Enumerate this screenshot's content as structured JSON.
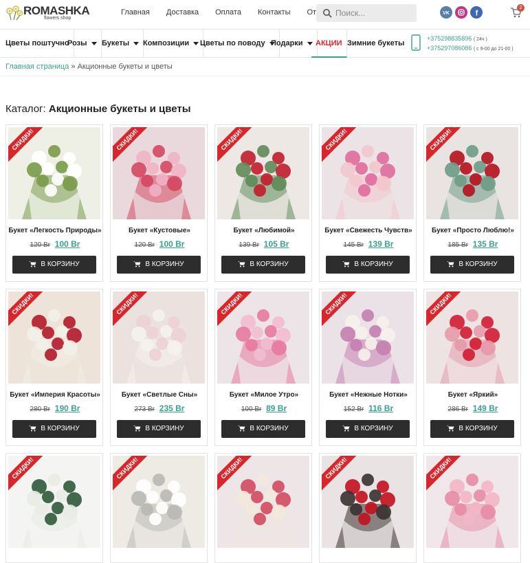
{
  "logo": {
    "brand": "ROMASHKA",
    "tagline": "flowers shop"
  },
  "topnav": [
    "Главная",
    "Доставка",
    "Оплата",
    "Контакты",
    "Отзывы"
  ],
  "search": {
    "placeholder": "Поиск..."
  },
  "social": [
    {
      "name": "vk-icon",
      "label": "VK",
      "color": "#5a7fa6"
    },
    {
      "name": "instagram-icon",
      "label": "",
      "color": "#c13584"
    },
    {
      "name": "facebook-icon",
      "label": "f",
      "color": "#4267b2"
    }
  ],
  "cart": {
    "count": "2"
  },
  "catnav": [
    {
      "label": "Цветы поштучно",
      "caret": false
    },
    {
      "label": "Розы",
      "caret": true
    },
    {
      "label": "Букеты",
      "caret": true
    },
    {
      "label": "Композиции",
      "caret": true
    },
    {
      "label": "Цветы по поводу",
      "caret": true
    },
    {
      "label": "Подарки",
      "caret": true
    },
    {
      "label": "АКЦИИ",
      "caret": false,
      "sale": true
    },
    {
      "label": "Зимние букеты",
      "caret": false
    }
  ],
  "phones": [
    {
      "number": "+375298835896",
      "note": "( 24ч )"
    },
    {
      "number": "+375297086086",
      "note": "( с 9-00 до 21-00 )"
    }
  ],
  "breadcrumb": {
    "home": "Главная страница",
    "sep": "»",
    "current": "Акционные букеты и цветы"
  },
  "title": {
    "prefix": "Каталог: ",
    "main": "Акционные букеты и цветы"
  },
  "sale_ribbon": "СКИДКИ!",
  "add_label": "В КОРЗИНУ",
  "colors": {
    "accent": "#3aa08f",
    "sale": "#d8262b",
    "button": "#2d2d2d"
  },
  "products": [
    {
      "name": "Букет «Легкость Природы»",
      "old": "120 Br",
      "new": "100 Br",
      "tone": [
        "#eef0e6",
        "#ffffff",
        "#7a9a4a"
      ]
    },
    {
      "name": "Букет «Кустовые»",
      "old": "120 Br",
      "new": "100 Br",
      "tone": [
        "#e9d9dc",
        "#f1b3c4",
        "#d4475f"
      ]
    },
    {
      "name": "Букет «Любимой»",
      "old": "139 Br",
      "new": "105 Br",
      "tone": [
        "#ede8e4",
        "#c01d2a",
        "#5e8a58"
      ]
    },
    {
      "name": "Букет «Свежесть Чувств»",
      "old": "145 Br",
      "new": "139 Br",
      "tone": [
        "#ebe3e6",
        "#e06b9c",
        "#f2c6cc"
      ]
    },
    {
      "name": "Букет «Просто Люблю!»",
      "old": "185 Br",
      "new": "135 Br",
      "tone": [
        "#e9e4e2",
        "#b5111d",
        "#6c9b86"
      ]
    },
    {
      "name": "Букет «Империя Красоты»",
      "old": "280 Br",
      "new": "190 Br",
      "tone": [
        "#eee3d8",
        "#b3192a",
        "#f2efe8"
      ]
    },
    {
      "name": "Букет «Светлые Сны»",
      "old": "273 Br",
      "new": "235 Br",
      "tone": [
        "#ebe1df",
        "#ecd1d4",
        "#f5f2ec"
      ]
    },
    {
      "name": "Букет «Милое Утро»",
      "old": "100 Br",
      "new": "89 Br",
      "tone": [
        "#ece4e6",
        "#f2bdd0",
        "#e87aa0"
      ]
    },
    {
      "name": "Букет «Нежные Нотки»",
      "old": "152 Br",
      "new": "116 Br",
      "tone": [
        "#eae2e6",
        "#f7f2ec",
        "#c47fb0"
      ]
    },
    {
      "name": "Букет «Яркий»",
      "old": "286 Br",
      "new": "149 Br",
      "tone": [
        "#ede3e3",
        "#d01b32",
        "#e69aa8"
      ]
    },
    {
      "name": "",
      "old": "",
      "new": "",
      "tone": [
        "#f4f4f2",
        "#2f5a3a",
        "#e8ece4"
      ]
    },
    {
      "name": "",
      "old": "",
      "new": "",
      "tone": [
        "#eeeae4",
        "#ffffff",
        "#b8b8b4"
      ]
    },
    {
      "name": "",
      "old": "",
      "new": "",
      "tone": [
        "#eee5e6",
        "#d24a60",
        "#f2e8dc"
      ]
    },
    {
      "name": "",
      "old": "",
      "new": "",
      "tone": [
        "#e9e3e3",
        "#c4101f",
        "#3a3030"
      ]
    },
    {
      "name": "",
      "old": "",
      "new": "",
      "tone": [
        "#efe7ea",
        "#f3b6c5",
        "#e58ca5"
      ]
    }
  ]
}
